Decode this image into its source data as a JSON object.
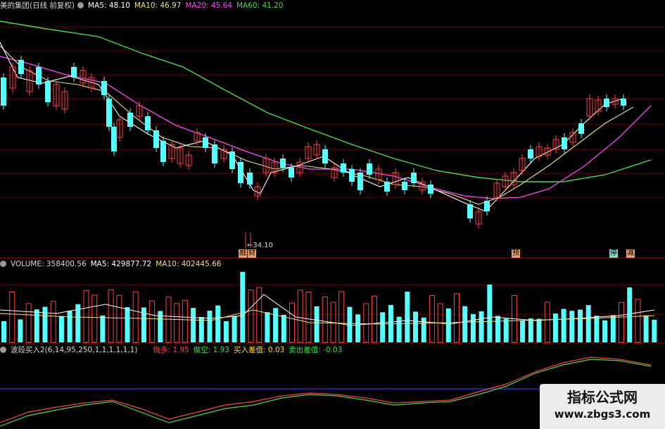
{
  "price_panel": {
    "title": "美的集团(日线 前复权)",
    "ma5": "MA5: 48.10",
    "ma10": "MA10: 46.97",
    "ma20": "MA20: 45.64",
    "ma60": "MA60: 41.20",
    "low_label": "←34.10",
    "event_tags": [
      "融",
      "财",
      "预",
      "停",
      "减"
    ],
    "colors": {
      "up": "#ff4040",
      "down": "#54ffff",
      "ma5": "#ffffff",
      "ma10": "#e6e68a",
      "ma20": "#ff44ff",
      "ma60": "#44dd44",
      "grid": "#7a0000"
    }
  },
  "volume_panel": {
    "title": "VOLUME: 358400.56",
    "ma5": "MA5: 429877.72",
    "ma10": "MA10: 402445.66"
  },
  "indicator_panel": {
    "title": "波段买入2(6,14,95,250,1,1,1,1,1,1)",
    "bull": "做多: 1.95",
    "bear": "做空: 1.93",
    "buy_diff": "买入差值: 0.03",
    "sell_diff": "卖出差值: -0.03"
  },
  "watermark": {
    "title": "指标公式网",
    "url": "www.zbgs3.com"
  }
}
